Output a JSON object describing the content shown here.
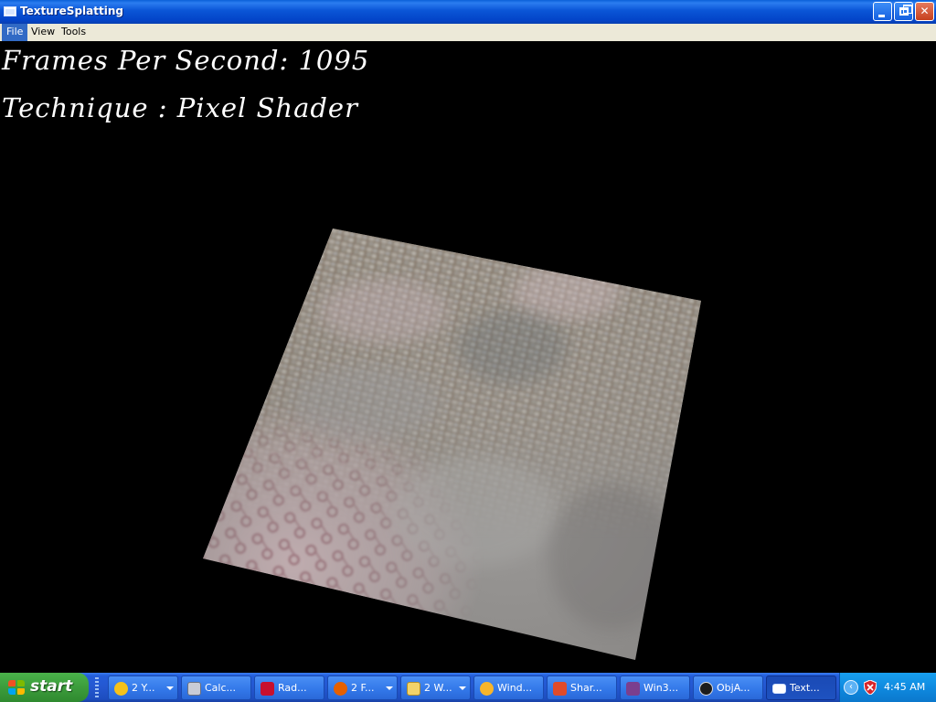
{
  "window": {
    "title": "TextureSplatting",
    "buttons": {
      "minimize": "minimize",
      "maximize": "restore",
      "close": "close"
    }
  },
  "menu": {
    "items": [
      {
        "label": "File",
        "active": true
      },
      {
        "label": "View",
        "active": false
      },
      {
        "label": "Tools",
        "active": false
      }
    ]
  },
  "hud": {
    "fps_line": "Frames Per Second: 1095",
    "technique_line": "Technique : Pixel Shader"
  },
  "scene": {
    "object": "splatted-terrain-quad",
    "colors": {
      "background": "#000000",
      "base_stone": "#8f8d8c",
      "cobble": "#9a8e80",
      "pink_pattern": "#b8a0a4",
      "hud_text": "#ffffff"
    }
  },
  "taskbar": {
    "start_label": "start",
    "tasks": [
      {
        "label": "2 Y...",
        "icon": "messenger-icon",
        "group": true,
        "active": false
      },
      {
        "label": "Calc...",
        "icon": "calculator-icon",
        "group": false,
        "active": false
      },
      {
        "label": "Rad...",
        "icon": "radeon-icon",
        "group": false,
        "active": false
      },
      {
        "label": "2 F...",
        "icon": "firefox-icon",
        "group": true,
        "active": false
      },
      {
        "label": "2 W...",
        "icon": "folder-icon",
        "group": true,
        "active": false
      },
      {
        "label": "Wind...",
        "icon": "media-player-icon",
        "group": false,
        "active": false
      },
      {
        "label": "Shar...",
        "icon": "sharpdevelop-icon",
        "group": false,
        "active": false
      },
      {
        "label": "Win3...",
        "icon": "help-book-icon",
        "group": false,
        "active": false
      },
      {
        "label": "ObjA...",
        "icon": "eye-icon",
        "group": false,
        "active": false
      },
      {
        "label": "Text...",
        "icon": "window-icon",
        "group": false,
        "active": true
      }
    ],
    "clock": "4:45 AM"
  }
}
